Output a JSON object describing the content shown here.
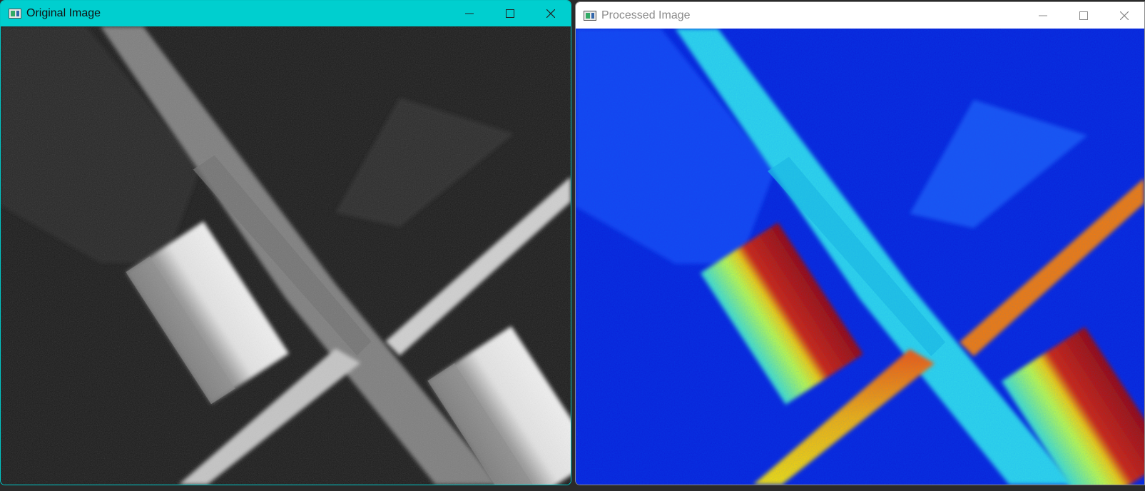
{
  "windows": {
    "original": {
      "title": "Original Image",
      "icon": "app-image-icon",
      "controls": [
        "minimize-icon",
        "maximize-icon",
        "close-icon"
      ],
      "accent": "#00cfcf",
      "colormap": "grayscale"
    },
    "processed": {
      "title": "Processed Image",
      "icon": "app-image-icon",
      "controls": [
        "minimize-icon",
        "maximize-icon",
        "close-icon"
      ],
      "colormap": "jet"
    }
  }
}
